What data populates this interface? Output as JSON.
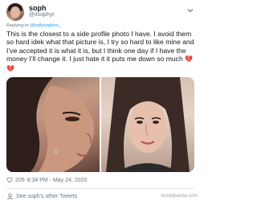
{
  "profile": {
    "name": "soph",
    "handle": "@itsophyt"
  },
  "reply": {
    "prefix": "Replying to",
    "to": "@hollyhopkins_"
  },
  "tweet": {
    "text": "This is the closest to a side profile photo I have. I avoid them so hard idek what that picture is, I try so hard to like mine and I’ve accepted it is what it is, but I think one day if I have the money I’ll change it. I just hate it it puts me down so much",
    "emoji": "💔💔"
  },
  "photos": {
    "left_icon": "side-profile-photo",
    "right_icon": "front-selfie-photo"
  },
  "footer": {
    "likes": "209",
    "timestamp": "8:34 PM - May 24, 2020"
  },
  "more": {
    "label": "See soph's other Tweets"
  },
  "watermark": "boredpanda.com",
  "colors": {
    "link": "#1da1f2",
    "muted": "#657786",
    "heart": "#e0245e"
  }
}
